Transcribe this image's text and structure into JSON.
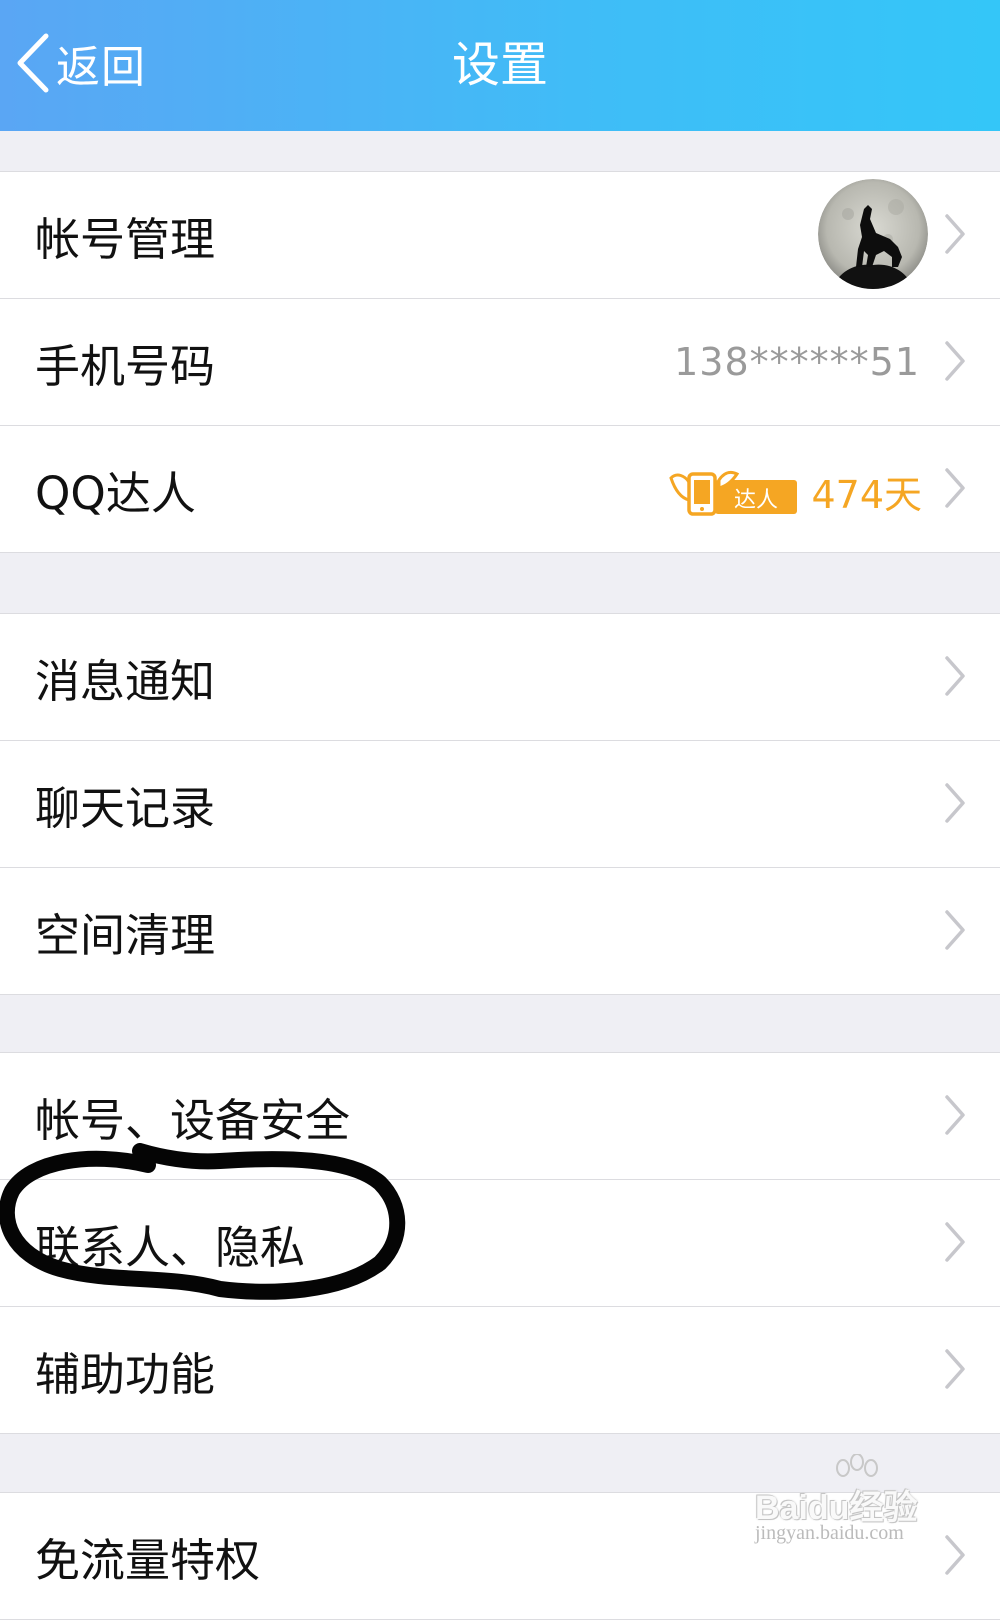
{
  "header": {
    "back_label": "返回",
    "title": "设置",
    "gradient": [
      "#5aa6f4",
      "#34c6f8"
    ]
  },
  "groups": [
    {
      "rows": [
        {
          "label": "帐号管理",
          "has_avatar": true
        },
        {
          "label": "手机号码",
          "value": "138******51"
        },
        {
          "label": "QQ达人",
          "badge_text": "达人",
          "value": "474天",
          "value_color": "#f5a623"
        }
      ]
    },
    {
      "rows": [
        {
          "label": "消息通知"
        },
        {
          "label": "聊天记录"
        },
        {
          "label": "空间清理"
        }
      ]
    },
    {
      "rows": [
        {
          "label": "帐号、设备安全"
        },
        {
          "label": "联系人、隐私",
          "highlighted": true
        },
        {
          "label": "辅助功能"
        }
      ]
    },
    {
      "rows": [
        {
          "label": "免流量特权"
        }
      ]
    }
  ],
  "watermark": {
    "main": "Baidu经验",
    "sub": "jingyan.baidu.com"
  }
}
